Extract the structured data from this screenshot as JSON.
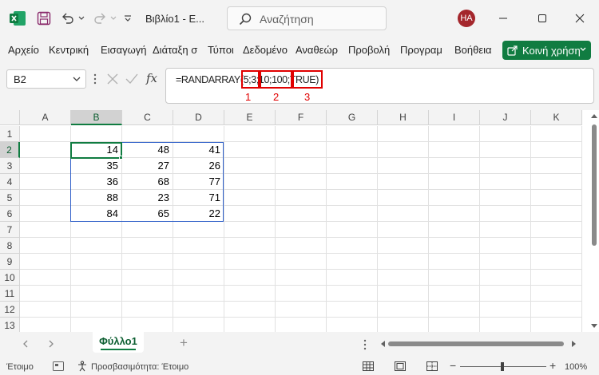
{
  "titlebar": {
    "doc_title": "Βιβλίο1  -  E...",
    "search_placeholder": "Αναζήτηση",
    "avatar_initials": "HA",
    "brand_color": "#107c41",
    "avatar_color": "#a4262c"
  },
  "ribbon": {
    "tabs": [
      "Αρχείο",
      "Κεντρική",
      "Εισαγωγή",
      "Διάταξη σ",
      "Τύποι",
      "Δεδομένο",
      "Αναθεώρ",
      "Προβολή",
      "Προγραμ",
      "Βοήθεια"
    ],
    "share_label": "Κοινή χρήση"
  },
  "formula": {
    "name_box": "B2",
    "fx_label": "fx",
    "prefix": "=RANDARRAY(",
    "arg1": "5;3",
    "sep1": ";",
    "arg2": "10;100",
    "sep2": ";",
    "arg3": "TRUE",
    "suffix": ")",
    "annotations": [
      "1",
      "2",
      "3"
    ],
    "highlight_color": "#e00000"
  },
  "grid": {
    "columns": [
      "A",
      "B",
      "C",
      "D",
      "E",
      "F",
      "G",
      "H",
      "I",
      "J",
      "K"
    ],
    "rows": [
      "1",
      "2",
      "3",
      "4",
      "5",
      "6",
      "7",
      "8",
      "9",
      "10",
      "11",
      "12",
      "13"
    ],
    "selected_cell": "B2",
    "values": [
      [
        "14",
        "48",
        "41"
      ],
      [
        "35",
        "27",
        "26"
      ],
      [
        "36",
        "68",
        "77"
      ],
      [
        "88",
        "23",
        "71"
      ],
      [
        "84",
        "65",
        "22"
      ]
    ]
  },
  "sheets": {
    "active": "Φύλλο1",
    "add_label": "+"
  },
  "status": {
    "ready": "Έτοιμο",
    "accessibility": "Προσβασιμότητα: Έτοιμο",
    "zoom": "100%",
    "zoom_minus": "−",
    "zoom_plus": "+"
  }
}
